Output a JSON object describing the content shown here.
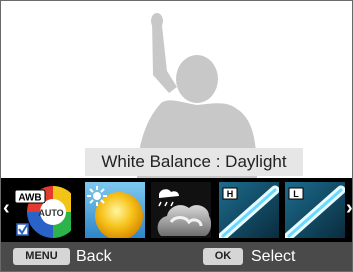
{
  "preview": {
    "subject": "person-silhouette-icon"
  },
  "white_balance": {
    "label": "White Balance : Daylight",
    "options": [
      {
        "name": "Auto White Balance",
        "icon": "awb-auto-icon",
        "badge": "AWB",
        "sub": "AUTO",
        "selected": false,
        "checked": true
      },
      {
        "name": "Daylight",
        "icon": "sun-icon",
        "selected": true
      },
      {
        "name": "Cloudy",
        "icon": "cloud-icon",
        "selected": false
      },
      {
        "name": "Fluorescent H",
        "icon": "fluorescent-h-icon",
        "badge": "H",
        "selected": false
      },
      {
        "name": "Fluorescent L",
        "icon": "fluorescent-l-icon",
        "badge": "L",
        "selected": false
      }
    ],
    "left_arrow": "‹",
    "right_arrow": "›"
  },
  "footer": {
    "menu_key": "MENU",
    "back_label": "Back",
    "ok_key": "OK",
    "select_label": "Select"
  },
  "colors": {
    "selection_outline": "#4fa3e6",
    "footer_bg": "#4a4a4a",
    "label_bg": "#e6e6e6"
  }
}
